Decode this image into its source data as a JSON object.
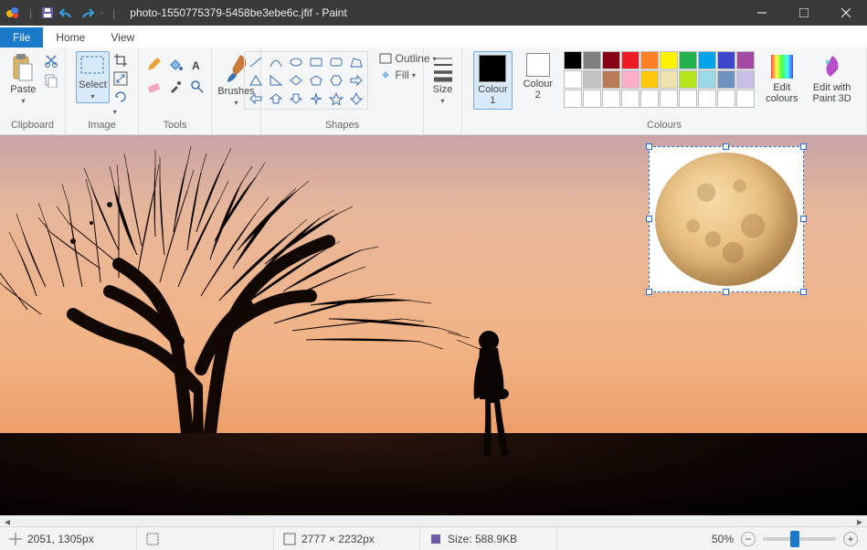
{
  "title": "photo-1550775379-5458be3ebe6c.jfif - Paint",
  "tabs": {
    "file": "File",
    "home": "Home",
    "view": "View"
  },
  "ribbon": {
    "clipboard": {
      "label": "Clipboard",
      "paste": "Paste"
    },
    "image": {
      "label": "Image",
      "select": "Select"
    },
    "tools": {
      "label": "Tools"
    },
    "brushes": {
      "label": "Brushes"
    },
    "shapes": {
      "label": "Shapes",
      "outline": "Outline",
      "fill": "Fill"
    },
    "size": {
      "label": "Size"
    },
    "colours": {
      "group_label": "Colours",
      "colour1": "Colour\n1",
      "colour2": "Colour\n2",
      "edit": "Edit\ncolours",
      "paint3d": "Edit with\nPaint 3D",
      "c1_value": "#000000",
      "c2_value": "#ffffff",
      "palette_row1": [
        "#000000",
        "#7f7f7f",
        "#880015",
        "#ed1c24",
        "#ff7f27",
        "#fff200",
        "#22b14c",
        "#00a2e8",
        "#3f48cc",
        "#a349a4"
      ],
      "palette_row2": [
        "#ffffff",
        "#c3c3c3",
        "#b97a57",
        "#ffaec9",
        "#ffc90e",
        "#efe4b0",
        "#b5e61d",
        "#99d9ea",
        "#7092be",
        "#c8bfe7"
      ],
      "palette_row3": [
        "#ffffff",
        "#ffffff",
        "#ffffff",
        "#ffffff",
        "#ffffff",
        "#ffffff",
        "#ffffff",
        "#ffffff",
        "#ffffff",
        "#ffffff"
      ]
    }
  },
  "status": {
    "cursor_pos": "2051, 1305px",
    "selection": "",
    "image_size": "2777 × 2232px",
    "file_size": "Size: 588.9KB",
    "zoom": "50%"
  }
}
